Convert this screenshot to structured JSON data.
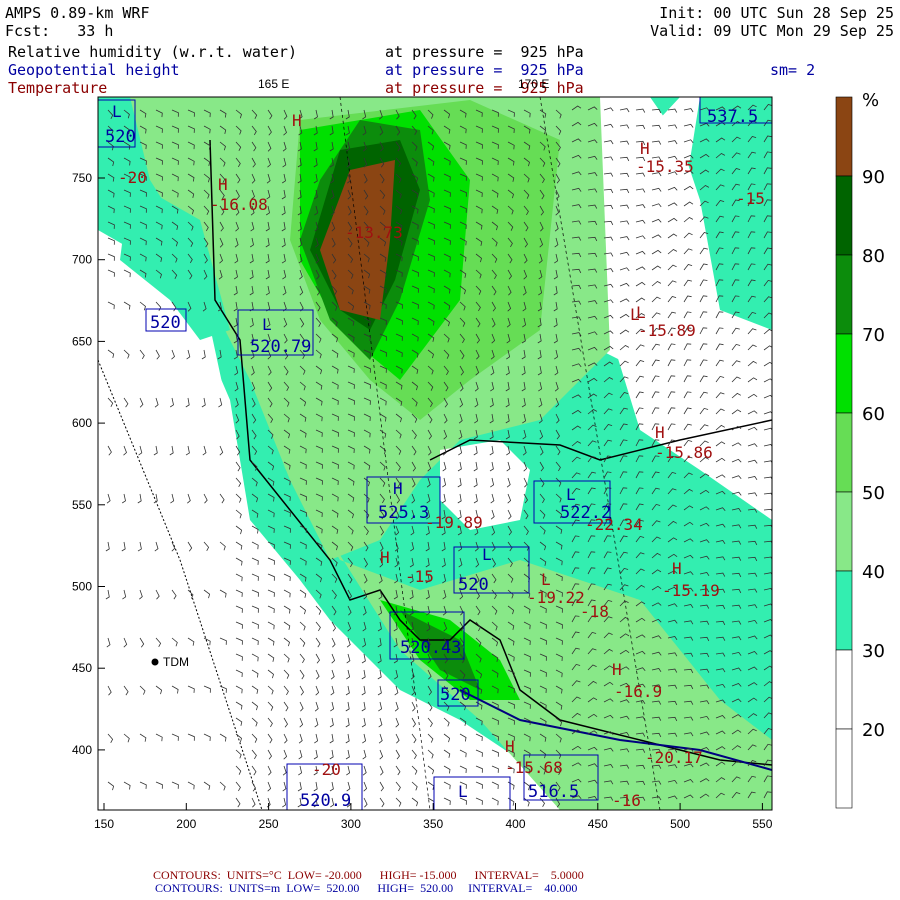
{
  "header": {
    "model": "AMPS 0.89-km WRF",
    "forecast": "Fcst:   33 h",
    "init": "Init: 00 UTC Sun 28 Sep 25",
    "valid": "Valid: 09 UTC Mon 29 Sep 25",
    "field1": "Relative humidity (w.r.t. water)",
    "field1_level": "at pressure =  925 hPa",
    "field2": "Geopotential height",
    "field2_level": "at pressure =  925 hPa",
    "field3": "Temperature",
    "field3_level": "at pressure =  925 hPa",
    "smoothing": "sm= 2",
    "lon_label_1": "165 E",
    "lon_label_2": "170 E"
  },
  "axes": {
    "x_ticks": [
      "150",
      "200",
      "250",
      "300",
      "350",
      "400",
      "450",
      "500",
      "550"
    ],
    "y_ticks": [
      "750",
      "700",
      "650",
      "600",
      "550",
      "500",
      "450",
      "400"
    ]
  },
  "colorbar": {
    "unit": "%",
    "labels": [
      "90",
      "80",
      "70",
      "60",
      "50",
      "40",
      "30",
      "20"
    ],
    "colors": [
      "#8b4513",
      "#006400",
      "#0c8c0c",
      "#00e000",
      "#66dd55",
      "#88e888",
      "#33eeb0",
      "#ffffff",
      "#ffffff"
    ]
  },
  "map": {
    "station": "TDM",
    "temperature_labels": [
      "-20",
      "-16.08",
      "-13.73",
      "-15.35",
      "-15",
      "-15.89",
      "-15.86",
      "-19.89",
      "-22.34",
      "-15",
      "-19.22",
      "-15.19",
      "-16.9",
      "-20.17",
      "-15.68",
      "-20",
      "-18",
      "-16"
    ],
    "height_labels": [
      "520",
      "520.79",
      "525.3",
      "522.2",
      "520",
      "520.43",
      "520",
      "537.5",
      "516.5",
      "520.9",
      "520"
    ],
    "hl_marks": [
      "L",
      "H",
      "H",
      "H",
      "L",
      "L",
      "H",
      "H",
      "L",
      "H",
      "L",
      "H",
      "L",
      "H",
      "H",
      "L",
      "L"
    ]
  },
  "footer": {
    "temp_contours": "CONTOURS:  UNITS=°C  LOW= -20.000      HIGH= -15.000      INTERVAL=    5.0000",
    "height_contours": "CONTOURS:  UNITS=m  LOW=  520.00      HIGH=  520.00     INTERVAL=    40.000"
  }
}
